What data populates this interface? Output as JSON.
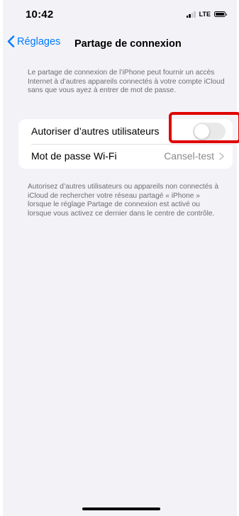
{
  "status_bar": {
    "time": "10:42",
    "network": "LTE",
    "signal_bars": 2,
    "signal_bars_total": 4,
    "battery_level": 1.0
  },
  "nav": {
    "back_label": "Réglages",
    "title": "Partage de connexion",
    "back_icon": "chevron-left-icon"
  },
  "top_note": "Le partage de connexion de l’iPhone peut fournir un accès Internet à d’autres appareils connectés à votre compte iCloud sans que vous ayez à entrer de mot de passe.",
  "settings": {
    "allow_others_label": "Autoriser d’autres utilisateurs",
    "allow_others_enabled": false,
    "wifi_password_label": "Mot de passe Wi-Fi",
    "wifi_password_value": "Cansel-test"
  },
  "bottom_note": "Autorisez d’autres utilisateurs ou appareils non connectés à iCloud de rechercher votre réseau partagé « iPhone » lorsque le réglage Partage de connexion est activé ou lorsque vous activez ce dernier dans le centre de contrôle.",
  "colors": {
    "accent": "#007aff",
    "background": "#f2f2f7",
    "highlight": "#e00000",
    "toggle_off": "#e9e9ea"
  }
}
